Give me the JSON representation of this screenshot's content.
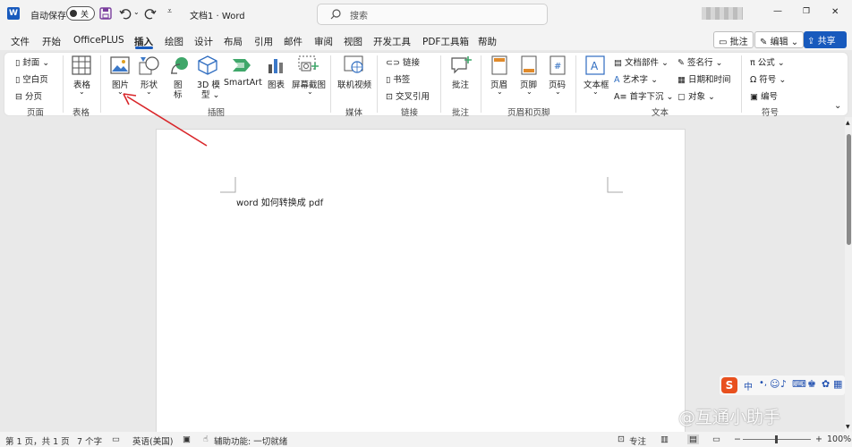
{
  "titlebar": {
    "autosave_label": "自动保存",
    "autosave_state": "关",
    "doc_title": "文档1 · Word",
    "search_placeholder": "搜索",
    "min": "—",
    "restore": "❐",
    "close": "✕"
  },
  "tabs": [
    "文件",
    "开始",
    "OfficePLUS",
    "插入",
    "绘图",
    "设计",
    "布局",
    "引用",
    "邮件",
    "审阅",
    "视图",
    "开发工具",
    "PDF工具箱",
    "帮助"
  ],
  "active_tab": "插入",
  "header_buttons": {
    "comments": "批注",
    "editing": "编辑",
    "share": "共享"
  },
  "ribbon": {
    "pages_group": {
      "cover": "封面",
      "blank": "空白页",
      "break": "分页",
      "label": "页面"
    },
    "table_group": {
      "table": "表格",
      "label": "表格"
    },
    "illustrations_group": {
      "picture": "图片",
      "shapes": "形状",
      "icons_1": "图",
      "icons_2": "标",
      "model_1": "3D 模",
      "model_2": "型",
      "smartart": "SmartArt",
      "chart": "图表",
      "screenshot": "屏幕截图",
      "label": "插图"
    },
    "media_group": {
      "video": "联机视频",
      "label": "媒体"
    },
    "links_group": {
      "link": "链接",
      "bookmark": "书签",
      "crossref": "交叉引用",
      "label": "链接"
    },
    "comments_group": {
      "comment": "批注",
      "label": "批注"
    },
    "header_footer_group": {
      "header": "页眉",
      "footer": "页脚",
      "page_number": "页码",
      "label": "页眉和页脚"
    },
    "text_group": {
      "textbox": "文本框",
      "quickparts": "文档部件",
      "wordart": "艺术字",
      "dropcap": "首字下沉",
      "signature": "签名行",
      "datetime": "日期和时间",
      "object": "对象",
      "label": "文本"
    },
    "symbols_group": {
      "equation": "公式",
      "symbol": "符号",
      "number": "编号",
      "label": "符号"
    }
  },
  "document": {
    "body_text": "word 如何转换成 pdf"
  },
  "statusbar": {
    "page": "第 1 页，共 1 页",
    "words": "7 个字",
    "language": "英语(美国)",
    "accessibility": "辅助功能: 一切就绪",
    "focus": "专注",
    "zoom": "100%"
  },
  "watermark": "@互通小助手",
  "ime_label": "中",
  "colors": {
    "accent": "#185abd",
    "arrow": "#d9262a",
    "ime": "#e8501e"
  }
}
